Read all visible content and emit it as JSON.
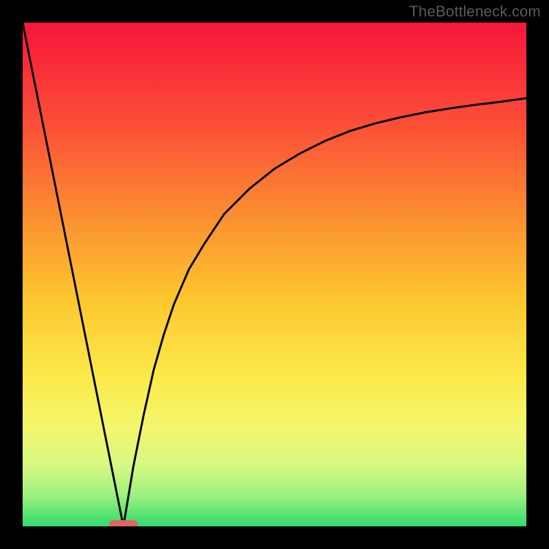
{
  "watermark": "TheBottleneck.com",
  "chart_data": {
    "type": "line",
    "title": "",
    "xlabel": "",
    "ylabel": "",
    "xlim": [
      0,
      100
    ],
    "ylim": [
      0,
      100
    ],
    "grid": false,
    "legend": false,
    "note": "Curve implied by visual cusp at x≈20, y=0; left branch nearly linear from (0,100) to (20,0); right branch steep then asymptotic toward y≈85 at x=100.",
    "x": [
      0,
      2,
      4,
      6,
      8,
      10,
      12,
      14,
      16,
      18,
      19,
      20,
      21,
      22,
      24,
      26,
      28,
      30,
      33,
      36,
      40,
      45,
      50,
      55,
      60,
      65,
      70,
      75,
      80,
      85,
      90,
      95,
      100
    ],
    "y": [
      100,
      90,
      80,
      70,
      60,
      50,
      40,
      30,
      20,
      10,
      5,
      0,
      6,
      12,
      22,
      31,
      38,
      44,
      51,
      56,
      62,
      67,
      71,
      74,
      76.5,
      78.5,
      80,
      81.2,
      82.2,
      83,
      83.7,
      84.3,
      85
    ],
    "marker": {
      "x": 20,
      "y": 0,
      "color": "#e06666",
      "shape": "rounded-bar"
    },
    "background_gradient": {
      "stops": [
        {
          "pos": 0.0,
          "color": "#f7163a"
        },
        {
          "pos": 0.2,
          "color": "#fb4e37"
        },
        {
          "pos": 0.4,
          "color": "#fb9430"
        },
        {
          "pos": 0.55,
          "color": "#fcc72f"
        },
        {
          "pos": 0.7,
          "color": "#fbe949"
        },
        {
          "pos": 0.8,
          "color": "#f4f66b"
        },
        {
          "pos": 0.88,
          "color": "#d6f882"
        },
        {
          "pos": 0.94,
          "color": "#9af07f"
        },
        {
          "pos": 1.0,
          "color": "#2fdc6e"
        }
      ]
    }
  }
}
